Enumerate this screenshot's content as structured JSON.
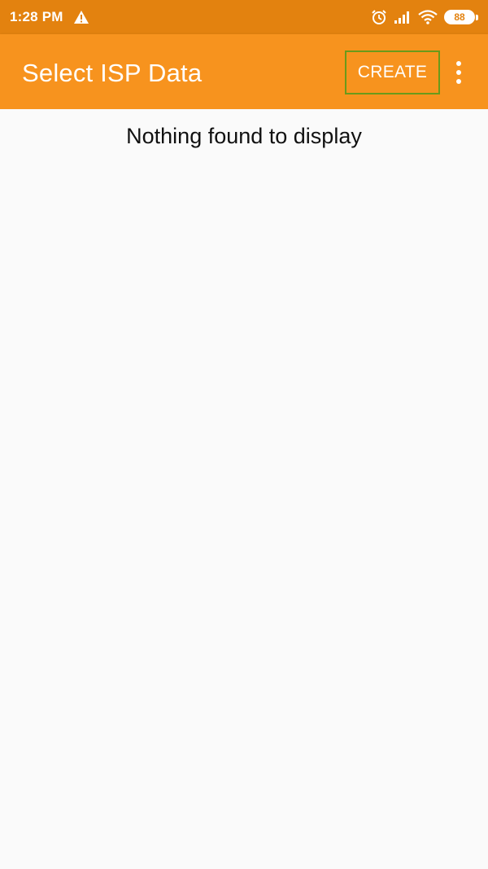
{
  "status_bar": {
    "time": "1:28 PM",
    "battery_level": "88",
    "icons": [
      "warning-icon",
      "alarm-icon",
      "signal-icon",
      "wifi-icon",
      "battery-icon"
    ]
  },
  "app_bar": {
    "title": "Select ISP Data",
    "create_label": "CREATE",
    "overflow_icon": "more-vert-icon"
  },
  "content": {
    "empty_message": "Nothing found to display"
  },
  "colors": {
    "status_bar": "#e3820f",
    "app_bar": "#f7931e",
    "background": "#fafafa",
    "highlight_border": "#6a9a1a"
  }
}
